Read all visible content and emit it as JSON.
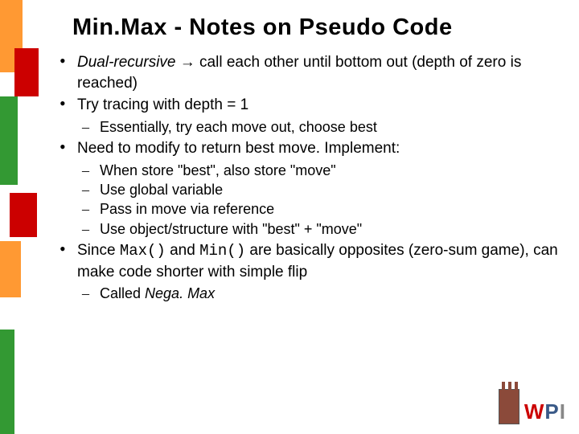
{
  "title": "Min.Max - Notes on Pseudo Code",
  "bullets": {
    "b0_pre": "Dual-recursive",
    "b0_arrow": " → ",
    "b0_post": "call each other until bottom out (depth of zero is reached)",
    "b1": "Try tracing with depth = 1",
    "b1_sub0": "Essentially, try each move out, choose best",
    "b2": "Need to modify to return best move.  Implement:",
    "b2_sub0": "When store \"best\", also store \"move\"",
    "b2_sub1": "Use global variable",
    "b2_sub2": "Pass in move via reference",
    "b2_sub3": "Use object/structure with \"best\" + \"move\"",
    "b3_a": "Since ",
    "b3_max": "Max()",
    "b3_b": " and ",
    "b3_min": "Min()",
    "b3_c": " are basically opposites (zero-sum game), can make code shorter with simple flip",
    "b3_sub0_a": "Called ",
    "b3_sub0_b": "Nega. Max"
  },
  "logo": {
    "w": "W",
    "p": "P",
    "i": "I"
  }
}
